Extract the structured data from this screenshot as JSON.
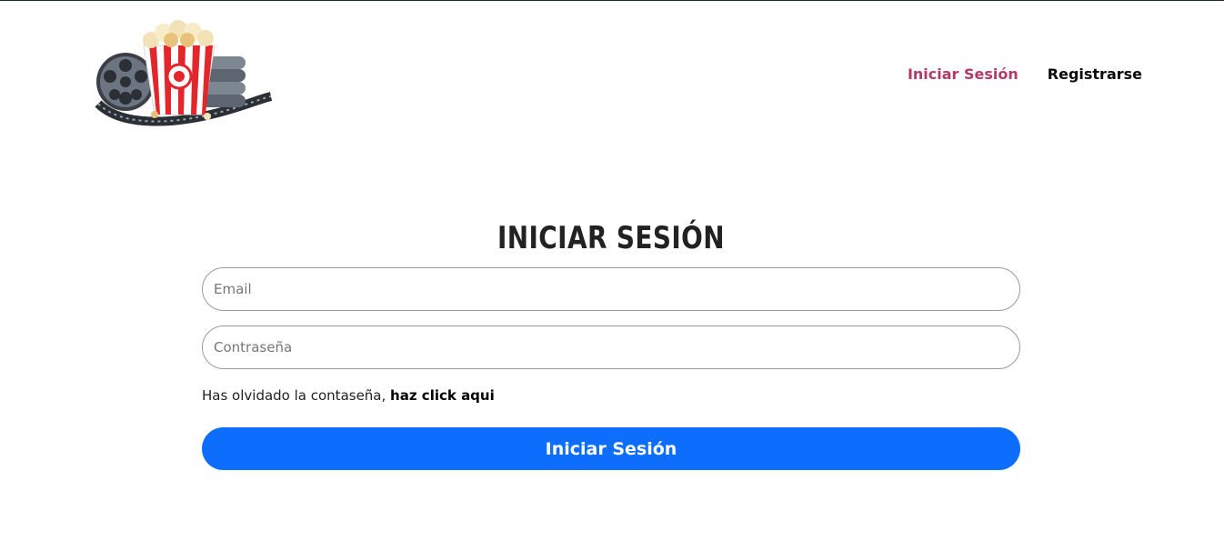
{
  "logo": {
    "icon": "cinema-popcorn-film-reel-logo"
  },
  "nav": {
    "items": [
      {
        "label": "Iniciar Sesión",
        "active": true
      },
      {
        "label": "Registrarse",
        "active": false
      }
    ]
  },
  "login": {
    "title": "Iniciar Sesión",
    "email_placeholder": "Email",
    "password_placeholder": "Contraseña",
    "forgot_text": "Has olvidado la contaseña, ",
    "forgot_link": "haz click aqui",
    "submit_label": "Iniciar Sesión"
  },
  "colors": {
    "accent_nav": "#b23a68",
    "primary_button": "#0d6efd"
  }
}
